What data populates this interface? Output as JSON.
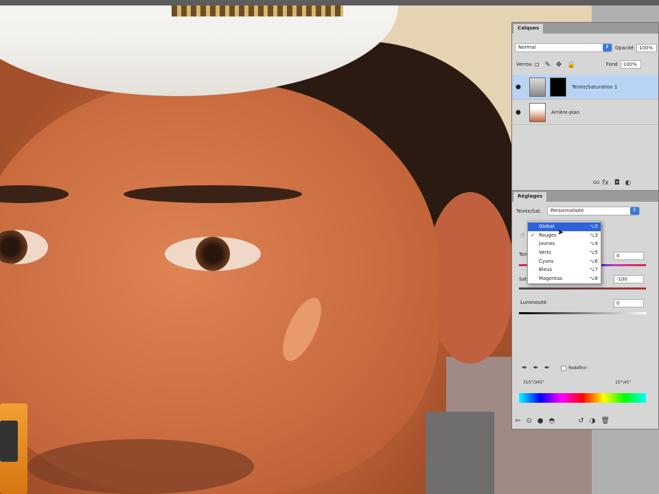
{
  "layers_panel": {
    "tab": "Calques",
    "blend_mode": "Normal",
    "opacity_label": "Opacité",
    "opacity_value": "100%",
    "lock_label": "Verrou",
    "fill_label": "Fond",
    "fill_value": "100%",
    "layers": [
      {
        "name": "Teinte/Saturation 1",
        "visible": true,
        "selected": true
      },
      {
        "name": "Arrière-plan",
        "visible": true,
        "selected": false
      }
    ],
    "footer_link": "GO"
  },
  "adjustments_panel": {
    "tab": "Réglages",
    "type_label": "Teinte/Sat.",
    "preset": "Personnalisée",
    "hue_label": "Teinte",
    "hue_value": "0",
    "saturation_label": "Saturation",
    "saturation_value": "-100",
    "lightness_label": "Luminosité",
    "lightness_value": "0",
    "colorize_label": "Redéfinir",
    "range_left": "315°/345°",
    "range_right": "15°\\45°"
  },
  "channel_menu": {
    "items": [
      {
        "label": "Global",
        "shortcut": "⌥2",
        "checked": false,
        "highlighted": true
      },
      {
        "label": "Rouges",
        "shortcut": "⌥3",
        "checked": true,
        "highlighted": false
      },
      {
        "label": "Jaunes",
        "shortcut": "⌥4",
        "checked": false,
        "highlighted": false
      },
      {
        "label": "Verts",
        "shortcut": "⌥5",
        "checked": false,
        "highlighted": false
      },
      {
        "label": "Cyans",
        "shortcut": "⌥6",
        "checked": false,
        "highlighted": false
      },
      {
        "label": "Bleus",
        "shortcut": "⌥7",
        "checked": false,
        "highlighted": false
      },
      {
        "label": "Magentas",
        "shortcut": "⌥8",
        "checked": false,
        "highlighted": false
      }
    ]
  }
}
